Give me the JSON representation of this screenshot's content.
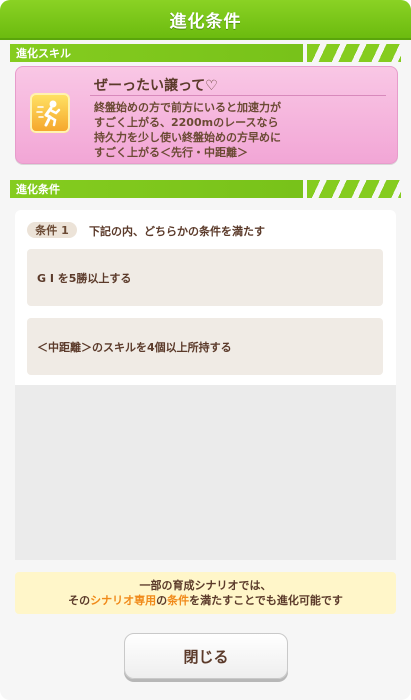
{
  "header": {
    "title": "進化条件"
  },
  "skill_section": {
    "label": "進化スキル",
    "skill": {
      "icon": "speed-up-runner-icon",
      "name": "ぜーったい譲って♡",
      "description_lines": [
        "終盤始めの方で前方にいると加速力が",
        "すごく上がる、2200mのレースなら",
        "持久力を少し使い終盤始めの方早めに",
        "すごく上がる＜先行・中距離＞"
      ]
    }
  },
  "condition_section": {
    "label": "進化条件",
    "chip": "条件 1",
    "instruction": "下記の内、どちらかの条件を満たす",
    "items": [
      "G I を5勝以上する",
      "＜中距離＞のスキルを4個以上所持する"
    ]
  },
  "notice": {
    "line1": "一部の育成シナリオでは、",
    "line2_pre": "その",
    "line2_hl1": "シナリオ専用",
    "line2_mid": "の",
    "line2_hl2": "条件",
    "line2_post": "を満たすことでも進化可能です"
  },
  "close_button": {
    "label": "閉じる"
  },
  "colors": {
    "accent_green": "#7cc41a",
    "skill_card_pink": "#f5b4dc",
    "highlight_orange": "#f08a1a"
  }
}
